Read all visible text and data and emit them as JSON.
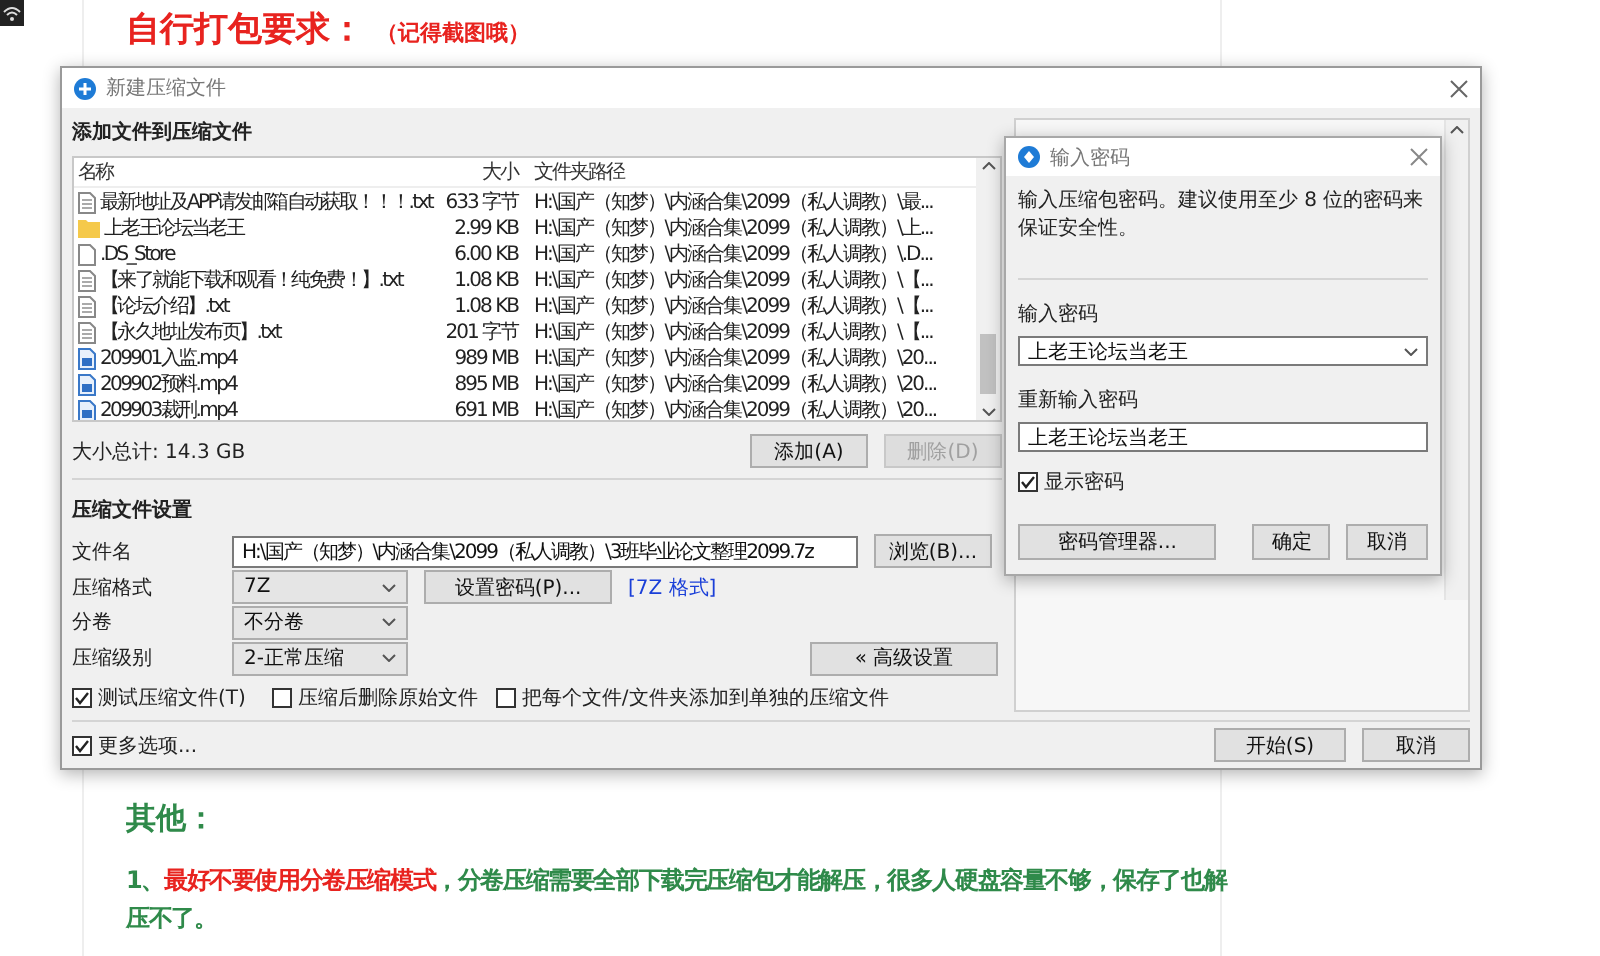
{
  "page": {
    "heading": "自行打包要求：",
    "heading_note": "（记得截图哦）",
    "section_title": "其他：",
    "paragraph": "1、**最好不要使用分卷压缩模式**，分卷压缩需要全部下载完压缩包才能解压，很多人硬盘容量不够，保存了也解压不了。"
  },
  "window": {
    "title": "新建压缩文件"
  },
  "files_section": {
    "title": "添加文件到压缩文件",
    "columns": [
      "名称",
      "大小",
      "文件夹路径"
    ],
    "rows": [
      {
        "kind": "text",
        "name": "最新地址及APP请发邮箱自动获取！！！.txt",
        "size": "633 字节",
        "path": "H:\\国产（知梦）\\内涵合集\\2099（私人调教）\\最..."
      },
      {
        "kind": "folder",
        "name": "上老王论坛当老王",
        "size": "2.99 KB",
        "path": "H:\\国产（知梦）\\内涵合集\\2099（私人调教）\\上..."
      },
      {
        "kind": "file",
        "name": ".DS_Store",
        "size": "6.00 KB",
        "path": "H:\\国产（知梦）\\内涵合集\\2099（私人调教）\\.D..."
      },
      {
        "kind": "text",
        "name": "【来了就能下载和观看！纯免费！】.txt",
        "size": "1.08 KB",
        "path": "H:\\国产（知梦）\\内涵合集\\2099（私人调教）\\【..."
      },
      {
        "kind": "text",
        "name": "【论坛介绍】.txt",
        "size": "1.08 KB",
        "path": "H:\\国产（知梦）\\内涵合集\\2099（私人调教）\\【..."
      },
      {
        "kind": "text",
        "name": "【永久地址发布页】.txt",
        "size": "201 字节",
        "path": "H:\\国产（知梦）\\内涵合集\\2099（私人调教）\\【..."
      },
      {
        "kind": "video",
        "name": "209901入监.mp4",
        "size": "989 MB",
        "path": "H:\\国产（知梦）\\内涵合集\\2099（私人调教）\\20..."
      },
      {
        "kind": "video",
        "name": "209902预料.mp4",
        "size": "895 MB",
        "path": "H:\\国产（知梦）\\内涵合集\\2099（私人调教）\\20..."
      },
      {
        "kind": "video",
        "name": "209903裁刑.mp4",
        "size": "691 MB",
        "path": "H:\\国产（知梦）\\内涵合集\\2099（私人调教）\\20..."
      }
    ],
    "total": "大小总计: 14.3 GB",
    "buttons": [
      {
        "label": "添加(A)",
        "disabled": false
      },
      {
        "label": "删除(D)",
        "disabled": true
      }
    ]
  },
  "settings": {
    "title": "压缩文件设置",
    "filename": {
      "label": "文件名",
      "value": "H:\\国产（知梦）\\内涵合集\\2099（私人调教）\\3班毕业论文整理2099.7z"
    },
    "browse_button": "浏览(B)...",
    "format": {
      "label": "压缩格式",
      "value": "7Z"
    },
    "password_button": "设置密码(P)...",
    "format_link": "[7Z 格式]",
    "split": {
      "label": "分卷",
      "value": "不分卷"
    },
    "level": {
      "label": "压缩级别",
      "value": "2-正常压缩"
    },
    "advanced_button": "« 高级设置",
    "options": [
      {
        "label": "测试压缩文件(T)",
        "checked": true
      },
      {
        "label": "压缩后删除原始文件",
        "checked": false
      },
      {
        "label": "把每个文件/文件夹添加到单独的压缩文件",
        "checked": false
      }
    ]
  },
  "footer": {
    "more_options": {
      "label": "更多选项...",
      "checked": true
    },
    "buttons": [
      "开始(S)",
      "取消"
    ]
  },
  "password_dialog": {
    "title": "输入密码",
    "message": "输入压缩包密码。建议使用至少 8 位的密码来保证安全性。",
    "password_label": "输入密码",
    "password_value": "上老王论坛当老王",
    "confirm_label": "重新输入密码",
    "confirm_value": "上老王论坛当老王",
    "show_password": {
      "label": "显示密码",
      "checked": true
    },
    "buttons": [
      "密码管理器...",
      "确定",
      "取消"
    ]
  }
}
